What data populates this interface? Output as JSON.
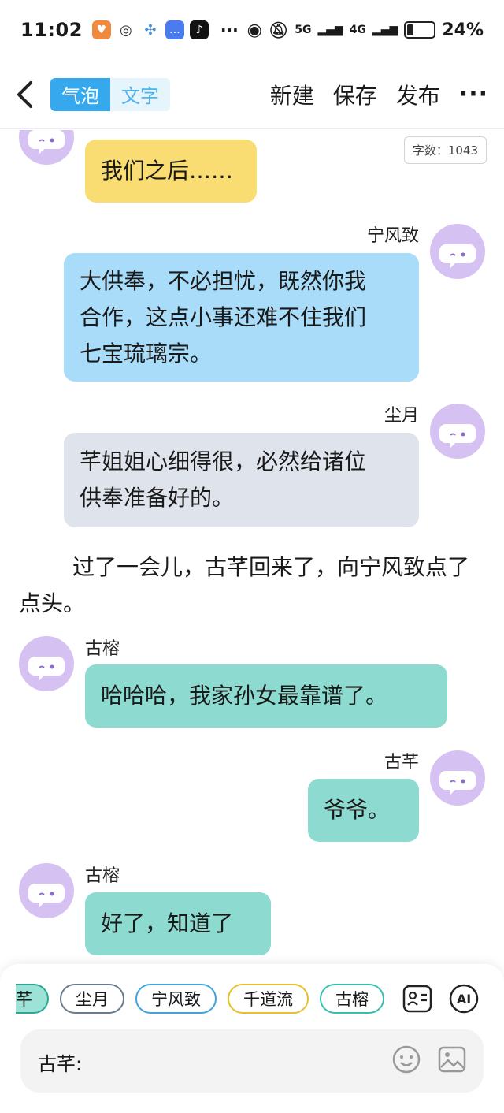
{
  "status_bar": {
    "time": "11:02",
    "battery_percent": "24%",
    "network_1": "5G",
    "network_2": "4G"
  },
  "topbar": {
    "mode_bubble": "气泡",
    "mode_text": "文字",
    "new_label": "新建",
    "save_label": "保存",
    "publish_label": "发布",
    "more_label": "···"
  },
  "word_count": "字数：1043",
  "messages": [
    {
      "text": "我们之后……",
      "color": "#f9dc72"
    },
    {
      "name": "宁风致",
      "text_lines": [
        "大供奉，不必担忧，既然你我",
        "合作，这点小事还难不住我们",
        "七宝琉璃宗。"
      ],
      "color": "#a9dcf9"
    },
    {
      "name": "尘月",
      "text_lines": [
        "芊姐姐心细得很，必然给诸位",
        "供奉准备好的。"
      ],
      "color": "#dfe4ec"
    },
    {
      "name": "古榕",
      "text": "哈哈哈，我家孙女最靠谱了。",
      "color": "#8ddbd0"
    },
    {
      "name": "古芊",
      "text": "爷爷。",
      "color": "#8ddbd0"
    },
    {
      "name": "古榕",
      "text": "好了，知道了",
      "color": "#8ddbd0"
    }
  ],
  "narration": "过了一会儿，古芊回来了，向宁风致点了点头。",
  "character_chips": [
    "芊",
    "尘月",
    "宁风致",
    "千道流",
    "古榕"
  ],
  "input": {
    "label": "古芊:"
  },
  "icons": [
    "back-arrow-icon",
    "more-icon",
    "avatar-face-icon",
    "profile-card-icon",
    "ai-icon",
    "emoji-icon",
    "image-icon"
  ]
}
